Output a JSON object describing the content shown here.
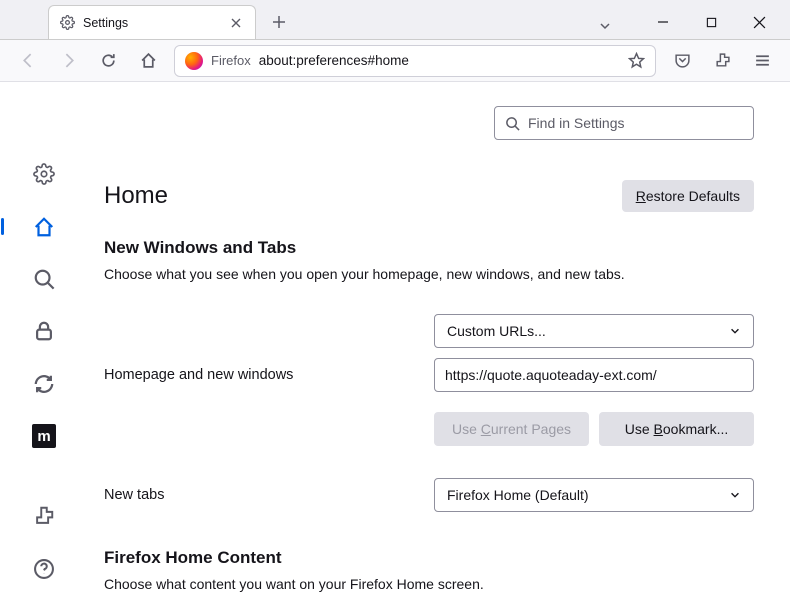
{
  "tab": {
    "label": "Settings"
  },
  "urlbar": {
    "label": "Firefox",
    "url": "about:preferences#home"
  },
  "search": {
    "placeholder": "Find in Settings"
  },
  "page": {
    "title": "Home",
    "restore": "estore Defaults",
    "restore_prefix": "R",
    "section1_title": "New Windows and Tabs",
    "section1_desc": "Choose what you see when you open your homepage, new windows, and new tabs.",
    "homepage_label": "Homepage and new windows",
    "homepage_select": "Custom URLs...",
    "homepage_url": "https://quote.aquoteaday-ext.com/",
    "use_current_prefix": "Use ",
    "use_current_u": "C",
    "use_current_suffix": "urrent Pages",
    "use_bookmark_prefix": "Use ",
    "use_bookmark_u": "B",
    "use_bookmark_suffix": "ookmark...",
    "newtabs_label": "New tabs",
    "newtabs_select": "Firefox Home (Default)",
    "section2_title": "Firefox Home Content",
    "section2_desc": "Choose what content you want on your Firefox Home screen."
  },
  "sidebar_m": "m"
}
